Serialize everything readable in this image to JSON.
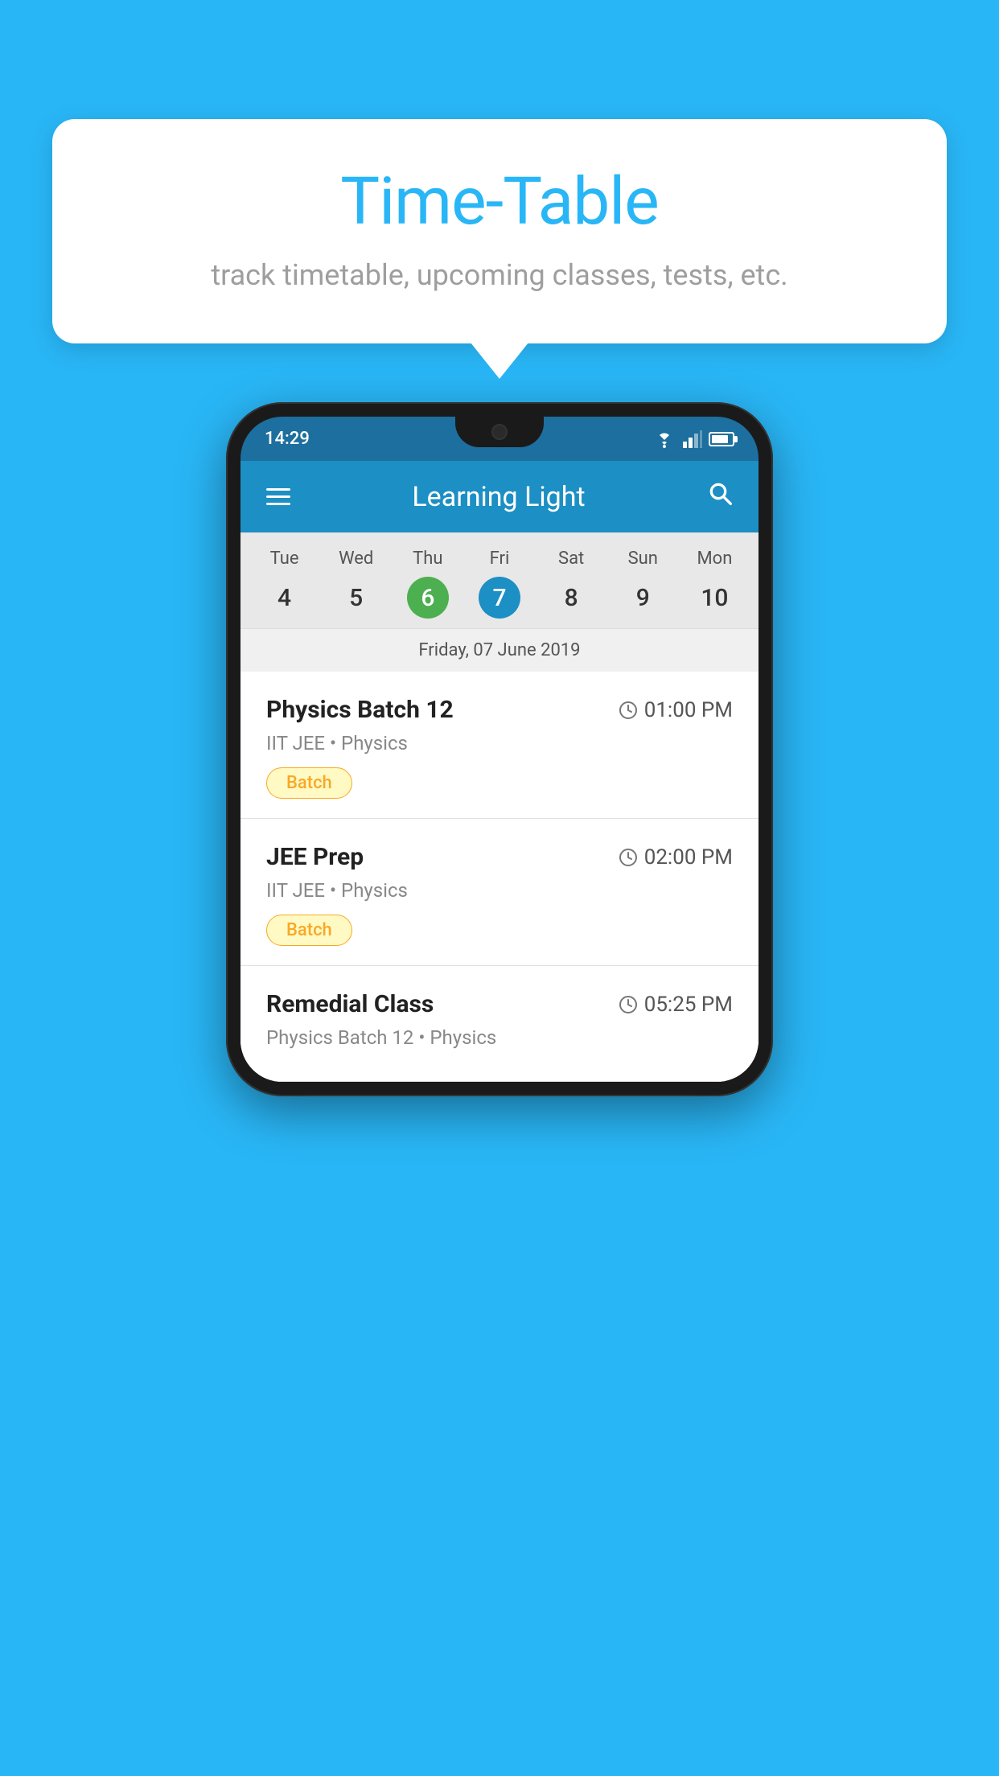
{
  "background_color": "#29B6F6",
  "tooltip": {
    "title": "Time-Table",
    "subtitle": "track timetable, upcoming classes, tests, etc."
  },
  "phone": {
    "status_bar": {
      "time": "14:29"
    },
    "app_bar": {
      "title": "Learning Light"
    },
    "calendar": {
      "days": [
        {
          "name": "Tue",
          "num": "4",
          "state": "normal"
        },
        {
          "name": "Wed",
          "num": "5",
          "state": "normal"
        },
        {
          "name": "Thu",
          "num": "6",
          "state": "today"
        },
        {
          "name": "Fri",
          "num": "7",
          "state": "selected"
        },
        {
          "name": "Sat",
          "num": "8",
          "state": "normal"
        },
        {
          "name": "Sun",
          "num": "9",
          "state": "normal"
        },
        {
          "name": "Mon",
          "num": "10",
          "state": "normal"
        }
      ],
      "selected_date_label": "Friday, 07 June 2019"
    },
    "schedule": [
      {
        "title": "Physics Batch 12",
        "time": "01:00 PM",
        "subtitle": "IIT JEE • Physics",
        "tag": "Batch"
      },
      {
        "title": "JEE Prep",
        "time": "02:00 PM",
        "subtitle": "IIT JEE • Physics",
        "tag": "Batch"
      },
      {
        "title": "Remedial Class",
        "time": "05:25 PM",
        "subtitle": "Physics Batch 12 • Physics",
        "tag": null
      }
    ]
  }
}
